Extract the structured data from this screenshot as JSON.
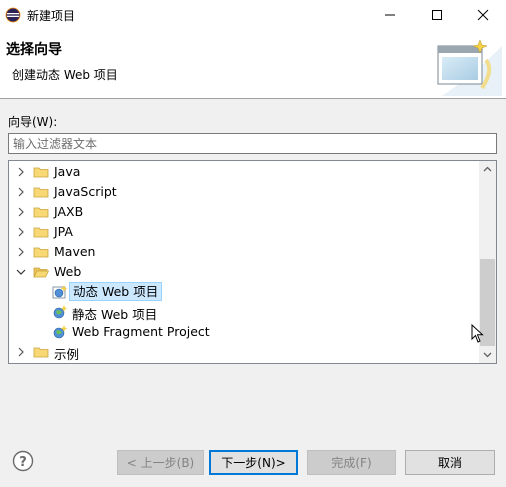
{
  "window": {
    "title": "新建项目"
  },
  "header": {
    "title": "选择向导",
    "description": "创建动态 Web 项目"
  },
  "wizard": {
    "label": "向导(W):",
    "filter_placeholder": "输入过滤器文本",
    "tree": [
      {
        "label": "Java",
        "expanded": false,
        "icon": "folder-icon"
      },
      {
        "label": "JavaScript",
        "expanded": false,
        "icon": "folder-icon"
      },
      {
        "label": "JAXB",
        "expanded": false,
        "icon": "folder-icon"
      },
      {
        "label": "JPA",
        "expanded": false,
        "icon": "folder-icon"
      },
      {
        "label": "Maven",
        "expanded": false,
        "icon": "folder-icon"
      },
      {
        "label": "Web",
        "expanded": true,
        "icon": "folder-open-icon",
        "children": [
          {
            "label": "动态 Web 项目",
            "selected": true,
            "icon": "dynamic-web-project-icon"
          },
          {
            "label": "静态 Web 项目",
            "icon": "static-web-project-icon"
          },
          {
            "label": "Web Fragment Project",
            "icon": "web-fragment-project-icon"
          }
        ]
      },
      {
        "label": "示例",
        "expanded": false,
        "icon": "folder-icon"
      }
    ]
  },
  "buttons": {
    "back": "< 上一步(B)",
    "next": "下一步(N)>",
    "finish": "完成(F)",
    "cancel": "取消"
  },
  "colors": {
    "selection_bg": "#cce8ff",
    "selection_border": "#99d1ff",
    "default_button_border": "#0078d7"
  }
}
